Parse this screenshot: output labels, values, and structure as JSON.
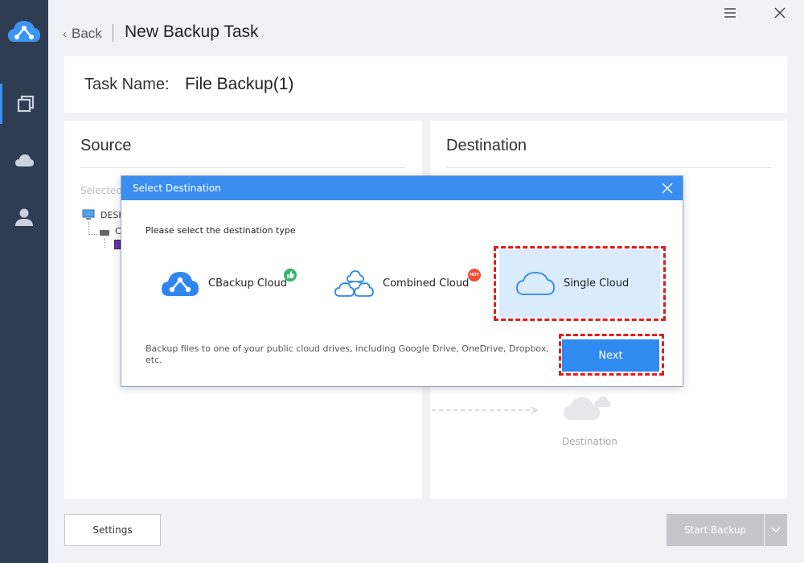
{
  "header": {
    "back_label": "Back",
    "title": "New Backup Task"
  },
  "sidebar": {
    "items": [
      {
        "icon": "copy-icon",
        "active": true
      },
      {
        "icon": "cloud-icon",
        "active": false
      },
      {
        "icon": "user-icon",
        "active": false
      }
    ]
  },
  "task": {
    "label": "Task Name:",
    "value": "File Backup(1)"
  },
  "source": {
    "title": "Source",
    "selected_hint": "Selected",
    "tree_root": "DESK",
    "tree_drive": "C"
  },
  "destination": {
    "title": "Destination",
    "target_label": "Destination"
  },
  "modal": {
    "title": "Select Destination",
    "prompt": "Please select the destination type",
    "options": [
      {
        "label": "CBackup Cloud",
        "badge": "like"
      },
      {
        "label": "Combined Cloud",
        "badge": "HOT"
      },
      {
        "label": "Single Cloud",
        "selected": true
      }
    ],
    "description": "Backup files to one of your public cloud drives, including Google Drive, OneDrive, Dropbox, etc.",
    "next_label": "Next"
  },
  "footer": {
    "settings_label": "Settings",
    "start_label": "Start Backup"
  },
  "colors": {
    "sidebar": "#2e3d52",
    "accent": "#3a8ef0",
    "highlight": "#e21b1b",
    "selected_bg": "#d9ebfd"
  }
}
